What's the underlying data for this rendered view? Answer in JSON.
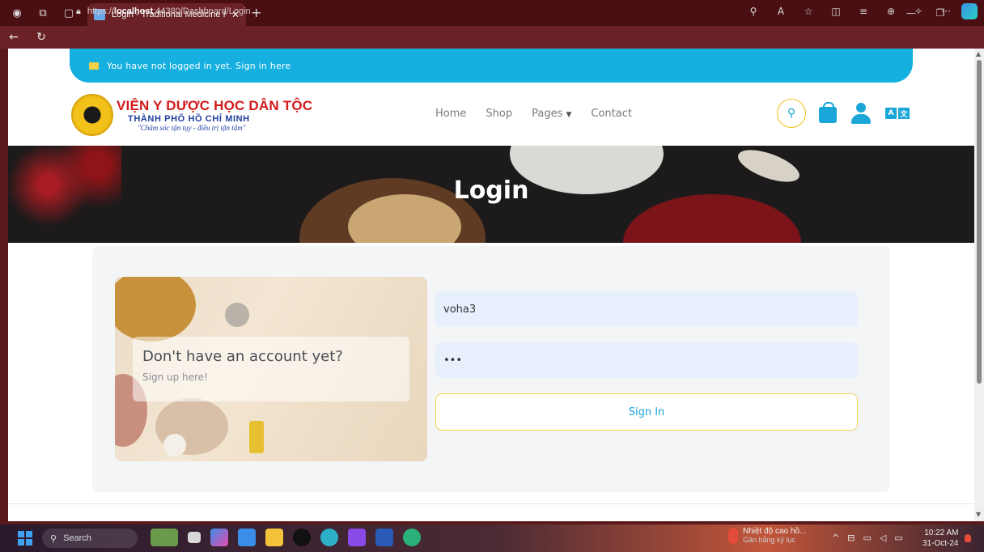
{
  "browser": {
    "tab_title": "Login - Traditional Medicine Hosp",
    "url_scheme": "https://",
    "url_host": "localhost",
    "url_rest": ":44380/Dashboard/Login"
  },
  "alert": {
    "text": "You have not logged in yet. Sign in here"
  },
  "brand": {
    "line1": "VIỆN Y DƯỢC HỌC DÂN TỘC",
    "line2": "THÀNH PHỐ HỒ CHÍ MINH",
    "line3": "\"Chăm sóc tận tụy - điều trị tận tâm\""
  },
  "nav": {
    "home": "Home",
    "shop": "Shop",
    "pages": "Pages",
    "contact": "Contact"
  },
  "banner": {
    "title": "Login"
  },
  "promo": {
    "title": "Don't have an account yet?",
    "link": "Sign up here!"
  },
  "form": {
    "username": "voha3",
    "password": "•••",
    "submit": "Sign In"
  },
  "taskbar": {
    "search": "Search",
    "weather_line1": "Nhiệt độ cao hồ...",
    "weather_line2": "Gần bằng kỷ lục",
    "time": "10:22 AM",
    "date": "31-Oct-24"
  },
  "colors": {
    "accent": "#1aa6d8",
    "brand_red": "#d21a1a",
    "brand_blue": "#1e3ea0",
    "chrome": "#6b2226"
  }
}
